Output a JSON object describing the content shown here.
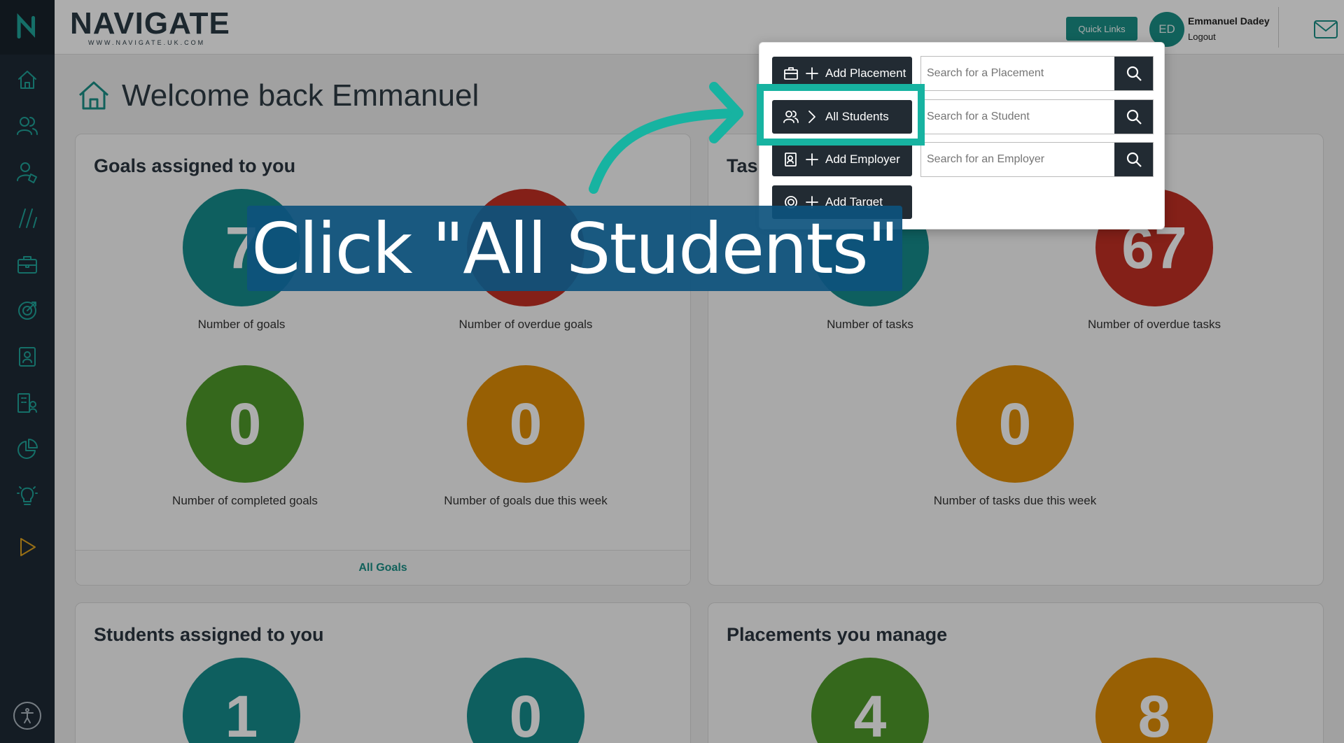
{
  "header": {
    "logo_text": "NAVIGATE",
    "logo_subtext": "WWW.NAVIGATE.UK.COM",
    "quick_links_label": "Quick Links",
    "avatar_initials": "ED",
    "user_name": "Emmanuel Dadey",
    "logout_label": "Logout"
  },
  "sidebar": {
    "brand_letter": "N",
    "items": [
      {
        "icon": "home-icon"
      },
      {
        "icon": "users-icon"
      },
      {
        "icon": "user-tag-icon"
      },
      {
        "icon": "slashes-icon"
      },
      {
        "icon": "briefcase-icon"
      },
      {
        "icon": "target-icon"
      },
      {
        "icon": "contact-card-icon"
      },
      {
        "icon": "building-user-icon"
      },
      {
        "icon": "pie-chart-icon"
      },
      {
        "icon": "lightbulb-icon"
      },
      {
        "icon": "play-icon"
      }
    ],
    "accessibility_icon": "accessibility-icon"
  },
  "page": {
    "title": "Welcome back Emmanuel"
  },
  "goals_card": {
    "title": "Goals assigned to you",
    "stats": [
      {
        "value": "7",
        "label": "Number of goals",
        "color": "#168c8c"
      },
      {
        "value": "",
        "label": "Number of overdue goals",
        "color": "#c33024"
      },
      {
        "value": "0",
        "label": "Number of completed goals",
        "color": "#4e9a2a"
      },
      {
        "value": "0",
        "label": "Number of goals due this week",
        "color": "#e08e07"
      }
    ],
    "footer_link": "All Goals"
  },
  "tasks_card": {
    "title": "Tasks",
    "stats": [
      {
        "value": "",
        "label": "Number of tasks",
        "color": "#168c8c"
      },
      {
        "value": "67",
        "label": "Number of overdue tasks",
        "color": "#c33024"
      },
      {
        "value": "0",
        "label": "Number of tasks due this week",
        "color": "#e08e07"
      }
    ]
  },
  "students_card": {
    "title": "Students assigned to you",
    "stats": [
      {
        "value": "1",
        "color": "#168c8c"
      },
      {
        "value": "0",
        "color": "#168c8c"
      }
    ]
  },
  "placements_card": {
    "title": "Placements you manage",
    "stats": [
      {
        "value": "4",
        "color": "#4e9a2a"
      },
      {
        "value": "8",
        "color": "#e08e07"
      }
    ]
  },
  "quick_links_menu": {
    "add_placement": "Add Placement",
    "all_students": "All Students",
    "add_employer": "Add Employer",
    "add_target": "Add Target",
    "search_placement_placeholder": "Search for a Placement",
    "search_student_placeholder": "Search for a Student",
    "search_employer_placeholder": "Search for an Employer"
  },
  "tutorial": {
    "instruction": "Click \"All Students\"",
    "highlight_color": "#17b3a1",
    "banner_color": "#0d527d"
  }
}
